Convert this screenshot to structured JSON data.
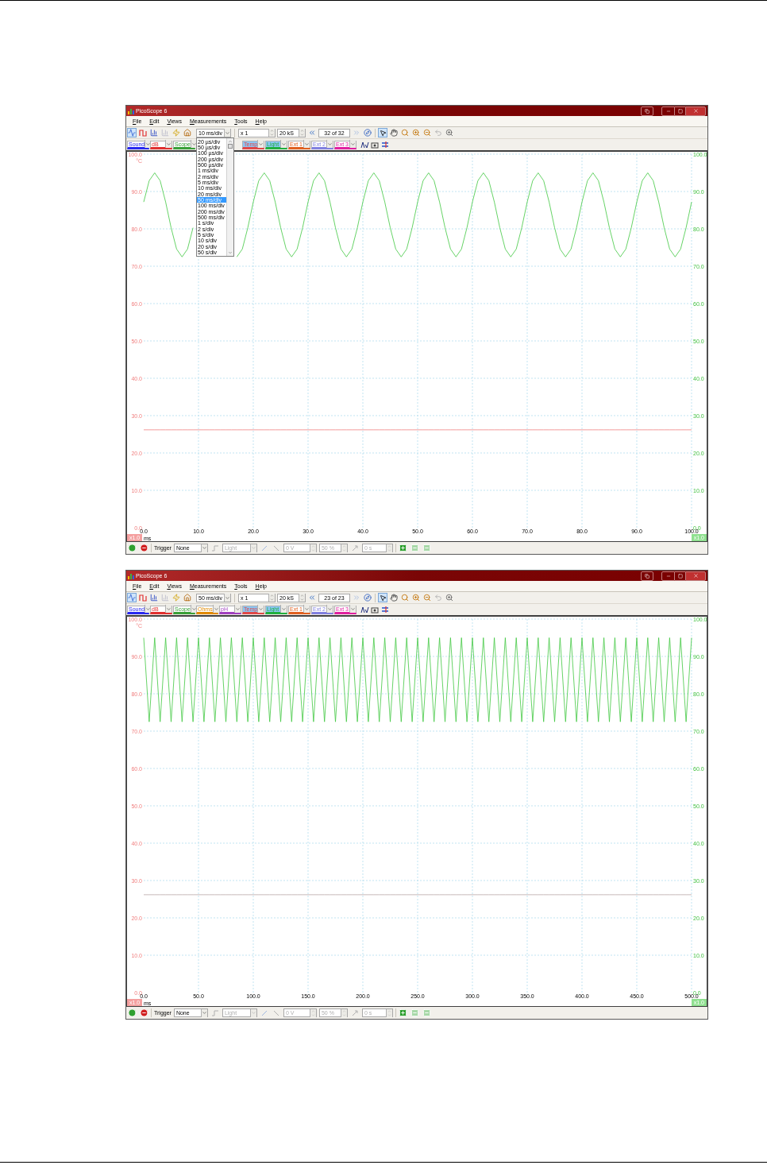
{
  "windows": [
    {
      "title": "PicoScope 6",
      "menu": [
        "File",
        "Edit",
        "Views",
        "Measurements",
        "Tools",
        "Help"
      ],
      "toolbar": {
        "timebase": "10 ms/div",
        "timebase_options": [
          {
            "label": "20 µs/div",
            "selected": false
          },
          {
            "label": "50 µs/div",
            "selected": false
          },
          {
            "label": "100 µs/div",
            "selected": false
          },
          {
            "label": "200 µs/div",
            "selected": false
          },
          {
            "label": "500 µs/div",
            "selected": false
          },
          {
            "label": "1 ms/div",
            "selected": false
          },
          {
            "label": "2 ms/div",
            "selected": false
          },
          {
            "label": "5 ms/div",
            "selected": false
          },
          {
            "label": "10 ms/div",
            "selected": false
          },
          {
            "label": "20 ms/div",
            "selected": false
          },
          {
            "label": "50 ms/div",
            "selected": true
          },
          {
            "label": "100 ms/div",
            "selected": false
          },
          {
            "label": "200 ms/div",
            "selected": false
          },
          {
            "label": "500 ms/div",
            "selected": false
          },
          {
            "label": "1 s/div",
            "selected": false
          },
          {
            "label": "2 s/div",
            "selected": false
          },
          {
            "label": "5 s/div",
            "selected": false
          },
          {
            "label": "10 s/div",
            "selected": false
          },
          {
            "label": "20 s/div",
            "selected": false
          },
          {
            "label": "50 s/div",
            "selected": false
          }
        ],
        "multiplier": "x 1",
        "samples": "20 kS",
        "buffer": "32 of 32"
      },
      "channels": [
        {
          "label": "Sound",
          "color": "#2828f0",
          "enabled": false
        },
        {
          "label": "dB",
          "color": "#e03030",
          "enabled": false
        },
        {
          "label": "Scope",
          "color": "#38a038",
          "enabled": false
        },
        {
          "label": "Temp",
          "color": "#e04848",
          "enabled": true
        },
        {
          "label": "Light",
          "color": "#20b040",
          "enabled": true
        },
        {
          "label": "Ext 1",
          "color": "#e06020",
          "enabled": false
        },
        {
          "label": "Ext 2",
          "color": "#8080e0",
          "enabled": false
        },
        {
          "label": "Ext 3",
          "color": "#e020a0",
          "enabled": false
        }
      ],
      "plot": {
        "left_scale": "x1.0",
        "right_scale": "x1.0",
        "right_axis": [
          "100.0",
          "90.0",
          "80.0",
          "70.0",
          "60.0",
          "50.0",
          "40.0",
          "30.0",
          "20.0",
          "10.0",
          "0.0"
        ],
        "chart_data": {
          "type": "line",
          "xlabel": "ms",
          "ylabel": "°C",
          "grid": true,
          "xlim": [
            0,
            100
          ],
          "ylim": [
            0,
            100
          ],
          "x": [
            0,
            1,
            2,
            3,
            4,
            5,
            6,
            7,
            8,
            9,
            10,
            11,
            12,
            13,
            14,
            15,
            16,
            17,
            18,
            19,
            20,
            21,
            22,
            23,
            24,
            25,
            26,
            27,
            28,
            29,
            30,
            31,
            32,
            33,
            34,
            35,
            36,
            37,
            38,
            39,
            40,
            41,
            42,
            43,
            44,
            45,
            46,
            47,
            48,
            49,
            50,
            51,
            52,
            53,
            54,
            55,
            56,
            57,
            58,
            59,
            60,
            61,
            62,
            63,
            64,
            65,
            66,
            67,
            68,
            69,
            70,
            71,
            72,
            73,
            74,
            75,
            76,
            77,
            78,
            79,
            80,
            81,
            82,
            83,
            84,
            85,
            86,
            87,
            88,
            89,
            90,
            91,
            92,
            93,
            94,
            95,
            96,
            97,
            98,
            99,
            100
          ],
          "xticks": [
            {
              "value": 0,
              "label": "0.0"
            },
            {
              "value": 10,
              "label": "10.0"
            },
            {
              "value": 20,
              "label": "20.0"
            },
            {
              "value": 30,
              "label": "30.0"
            },
            {
              "value": 40,
              "label": "40.0"
            },
            {
              "value": 50,
              "label": "50.0"
            },
            {
              "value": 60,
              "label": "60.0"
            },
            {
              "value": 70,
              "label": "70.0"
            },
            {
              "value": 80,
              "label": "80.0"
            },
            {
              "value": 90,
              "label": "90.0"
            },
            {
              "value": 100,
              "label": "100.0"
            }
          ],
          "yticks": [
            {
              "value": 0,
              "label": "0.0"
            },
            {
              "value": 10,
              "label": "10.0"
            },
            {
              "value": 20,
              "label": "20.0"
            },
            {
              "value": 30,
              "label": "30.0"
            },
            {
              "value": 40,
              "label": "40.0"
            },
            {
              "value": 50,
              "label": "50.0"
            },
            {
              "value": 60,
              "label": "60.0"
            },
            {
              "value": 70,
              "label": "70.0"
            },
            {
              "value": 80,
              "label": "80.0"
            },
            {
              "value": 90,
              "label": "90.0"
            },
            {
              "value": 100,
              "label": "100.0"
            }
          ],
          "series": [
            {
              "color": "#40c840",
              "values": [
                87.2,
                92.9,
                95.0,
                92.9,
                87.2,
                80.3,
                74.6,
                72.5,
                74.6,
                80.3,
                null,
                null,
                null,
                null,
                null,
                null,
                null,
                72.5,
                74.6,
                80.3,
                87.2,
                92.9,
                95.0,
                92.9,
                87.2,
                80.3,
                74.6,
                72.5,
                74.6,
                80.3,
                87.2,
                92.9,
                95.0,
                92.9,
                87.2,
                80.3,
                74.6,
                72.5,
                74.6,
                80.3,
                87.2,
                92.9,
                95.0,
                92.9,
                87.2,
                80.3,
                74.6,
                72.5,
                74.6,
                80.3,
                87.2,
                92.9,
                95.0,
                92.9,
                87.2,
                80.3,
                74.6,
                72.5,
                74.6,
                80.3,
                87.2,
                92.9,
                95.0,
                92.9,
                87.2,
                80.3,
                74.6,
                72.5,
                74.6,
                80.3,
                87.2,
                92.9,
                95.0,
                92.9,
                87.2,
                80.3,
                74.6,
                72.5,
                74.6,
                80.3,
                87.2,
                92.9,
                95.0,
                92.9,
                87.2,
                80.3,
                74.6,
                72.5,
                74.6,
                80.3,
                87.2,
                92.9,
                95.0,
                92.9,
                87.2,
                80.3,
                74.6,
                72.5,
                74.6,
                80.3,
                87.2
              ]
            },
            {
              "color": "#f08080",
              "values": [
                26.2,
                26.2,
                26.2,
                26.2,
                26.2,
                26.2,
                26.2,
                26.2,
                26.2,
                26.2,
                26.2,
                26.2,
                26.2,
                26.2,
                26.2,
                26.2,
                26.2,
                26.2,
                26.2,
                26.2,
                26.2,
                26.2,
                26.2,
                26.2,
                26.2,
                26.2,
                26.2,
                26.2,
                26.2,
                26.2,
                26.2,
                26.2,
                26.2,
                26.2,
                26.2,
                26.2,
                26.2,
                26.2,
                26.2,
                26.2,
                26.2,
                26.2,
                26.2,
                26.2,
                26.2,
                26.2,
                26.2,
                26.2,
                26.2,
                26.2,
                26.2,
                26.2,
                26.2,
                26.2,
                26.2,
                26.2,
                26.2,
                26.2,
                26.2,
                26.2,
                26.2,
                26.2,
                26.2,
                26.2,
                26.2,
                26.2,
                26.2,
                26.2,
                26.2,
                26.2,
                26.2,
                26.2,
                26.2,
                26.2,
                26.2,
                26.2,
                26.2,
                26.2,
                26.2,
                26.2,
                26.2,
                26.2,
                26.2,
                26.2,
                26.2,
                26.2,
                26.2,
                26.2,
                26.2,
                26.2,
                26.2,
                26.2,
                26.2,
                26.2,
                26.2,
                26.2,
                26.2,
                26.2,
                26.2,
                26.2,
                26.2
              ]
            }
          ]
        }
      },
      "status_bar": {
        "trigger_label": "Trigger",
        "trigger_mode": "None",
        "trigger_source": {
          "value": "Light",
          "disabled": true
        },
        "threshold": {
          "value": "0 V",
          "disabled": true
        },
        "pretrigger": {
          "value": "50 %",
          "disabled": true
        },
        "delay": {
          "value": "0 s",
          "disabled": true
        }
      }
    },
    {
      "title": "PicoScope 6",
      "menu": [
        "File",
        "Edit",
        "Views",
        "Measurements",
        "Tools",
        "Help"
      ],
      "toolbar": {
        "timebase": "50 ms/div",
        "multiplier": "x 1",
        "samples": "20 kS",
        "buffer": "23 of 23"
      },
      "channels": [
        {
          "label": "Sound",
          "color": "#2828f0",
          "enabled": false
        },
        {
          "label": "dB",
          "color": "#e03030",
          "enabled": false
        },
        {
          "label": "Scope",
          "color": "#38a038",
          "enabled": false
        },
        {
          "label": "Ohms",
          "color": "#e08a00",
          "enabled": false
        },
        {
          "label": "pH",
          "color": "#a040c0",
          "enabled": false
        },
        {
          "label": "Temp",
          "color": "#e04848",
          "enabled": true
        },
        {
          "label": "Light",
          "color": "#20b040",
          "enabled": true
        },
        {
          "label": "Ext 1",
          "color": "#e06020",
          "enabled": false
        },
        {
          "label": "Ext 2",
          "color": "#8080e0",
          "enabled": false
        },
        {
          "label": "Ext 3",
          "color": "#e020a0",
          "enabled": false
        }
      ],
      "plot": {
        "left_scale": "x1.0",
        "right_scale": "x1.0",
        "right_axis": [
          "100.0",
          "90.0",
          "80.0",
          "70.0",
          "60.0",
          "50.0",
          "40.0",
          "30.0",
          "20.0",
          "10.0",
          "0.0"
        ],
        "chart_data": {
          "type": "line",
          "xlabel": "ms",
          "ylabel": "°C",
          "grid": true,
          "xlim": [
            0,
            500
          ],
          "ylim": [
            0,
            100
          ],
          "x": [
            0,
            5,
            10,
            15,
            20,
            25,
            30,
            35,
            40,
            45,
            50,
            55,
            60,
            65,
            70,
            75,
            80,
            85,
            90,
            95,
            100,
            105,
            110,
            115,
            120,
            125,
            130,
            135,
            140,
            145,
            150,
            155,
            160,
            165,
            170,
            175,
            180,
            185,
            190,
            195,
            200,
            205,
            210,
            215,
            220,
            225,
            230,
            235,
            240,
            245,
            250,
            255,
            260,
            265,
            270,
            275,
            280,
            285,
            290,
            295,
            300,
            305,
            310,
            315,
            320,
            325,
            330,
            335,
            340,
            345,
            350,
            355,
            360,
            365,
            370,
            375,
            380,
            385,
            390,
            395,
            400,
            405,
            410,
            415,
            420,
            425,
            430,
            435,
            440,
            445,
            450,
            455,
            460,
            465,
            470,
            475,
            480,
            485,
            490,
            495,
            500
          ],
          "xticks": [
            {
              "value": 0,
              "label": "0.0"
            },
            {
              "value": 50,
              "label": "50.0"
            },
            {
              "value": 100,
              "label": "100.0"
            },
            {
              "value": 150,
              "label": "150.0"
            },
            {
              "value": 200,
              "label": "200.0"
            },
            {
              "value": 250,
              "label": "250.0"
            },
            {
              "value": 300,
              "label": "300.0"
            },
            {
              "value": 350,
              "label": "350.0"
            },
            {
              "value": 400,
              "label": "400.0"
            },
            {
              "value": 450,
              "label": "450.0"
            },
            {
              "value": 500,
              "label": "500.0"
            }
          ],
          "yticks": [
            {
              "value": 0,
              "label": "0.0"
            },
            {
              "value": 10,
              "label": "10.0"
            },
            {
              "value": 20,
              "label": "20.0"
            },
            {
              "value": 30,
              "label": "30.0"
            },
            {
              "value": 40,
              "label": "40.0"
            },
            {
              "value": 50,
              "label": "50.0"
            },
            {
              "value": 60,
              "label": "60.0"
            },
            {
              "value": 70,
              "label": "70.0"
            },
            {
              "value": 80,
              "label": "80.0"
            },
            {
              "value": 90,
              "label": "90.0"
            },
            {
              "value": 100,
              "label": "100.0"
            }
          ],
          "series": [
            {
              "color": "#40c840",
              "values": [
                95.0,
                72.5,
                95.0,
                72.5,
                95.0,
                72.5,
                95.0,
                72.5,
                95.0,
                72.5,
                95.0,
                72.5,
                95.0,
                72.5,
                95.0,
                72.5,
                95.0,
                72.5,
                95.0,
                72.5,
                95.0,
                72.5,
                95.0,
                72.5,
                95.0,
                72.5,
                95.0,
                72.5,
                95.0,
                72.5,
                95.0,
                72.5,
                95.0,
                72.5,
                95.0,
                72.5,
                95.0,
                72.5,
                95.0,
                72.5,
                95.0,
                72.5,
                95.0,
                72.5,
                95.0,
                72.5,
                95.0,
                72.5,
                95.0,
                72.5,
                95.0,
                72.5,
                95.0,
                72.5,
                95.0,
                72.5,
                95.0,
                72.5,
                95.0,
                72.5,
                95.0,
                72.5,
                95.0,
                72.5,
                95.0,
                72.5,
                95.0,
                72.5,
                95.0,
                72.5,
                95.0,
                72.5,
                95.0,
                72.5,
                95.0,
                72.5,
                95.0,
                72.5,
                95.0,
                72.5,
                95.0,
                72.5,
                95.0,
                72.5,
                95.0,
                72.5,
                95.0,
                72.5,
                95.0,
                72.5,
                95.0,
                72.5,
                95.0,
                72.5,
                95.0,
                72.5,
                95.0,
                72.5,
                95.0,
                72.5,
                95.0
              ]
            },
            {
              "color": "#b8a8a8",
              "values": [
                26.2,
                26.2,
                26.2,
                26.2,
                26.2,
                26.2,
                26.2,
                26.2,
                26.2,
                26.2,
                26.2,
                26.2,
                26.2,
                26.2,
                26.2,
                26.2,
                26.2,
                26.2,
                26.2,
                26.2,
                26.2,
                26.2,
                26.2,
                26.2,
                26.2,
                26.2,
                26.2,
                26.2,
                26.2,
                26.2,
                26.2,
                26.2,
                26.2,
                26.2,
                26.2,
                26.2,
                26.2,
                26.2,
                26.2,
                26.2,
                26.2,
                26.2,
                26.2,
                26.2,
                26.2,
                26.2,
                26.2,
                26.2,
                26.2,
                26.2,
                26.2,
                26.2,
                26.2,
                26.2,
                26.2,
                26.2,
                26.2,
                26.2,
                26.2,
                26.2,
                26.2,
                26.2,
                26.2,
                26.2,
                26.2,
                26.2,
                26.2,
                26.2,
                26.2,
                26.2,
                26.2,
                26.2,
                26.2,
                26.2,
                26.2,
                26.2,
                26.2,
                26.2,
                26.2,
                26.2,
                26.2,
                26.2,
                26.2,
                26.2,
                26.2,
                26.2,
                26.2,
                26.2,
                26.2,
                26.2,
                26.2,
                26.2,
                26.2,
                26.2,
                26.2,
                26.2,
                26.2,
                26.2,
                26.2,
                26.2,
                26.2
              ]
            }
          ]
        }
      },
      "status_bar": {
        "trigger_label": "Trigger",
        "trigger_mode": "None",
        "trigger_source": {
          "value": "Light",
          "disabled": true
        },
        "threshold": {
          "value": "0 V",
          "disabled": true
        },
        "pretrigger": {
          "value": "50 %",
          "disabled": true
        },
        "delay": {
          "value": "0 s",
          "disabled": true
        }
      }
    }
  ]
}
